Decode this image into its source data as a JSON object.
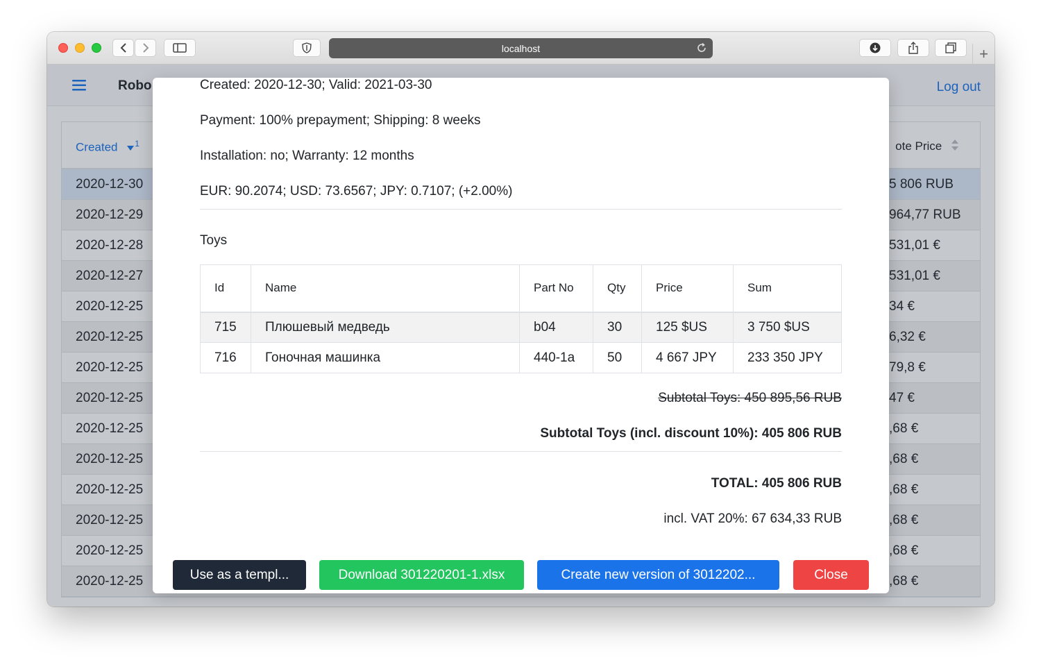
{
  "browser": {
    "url": "localhost",
    "icons": [
      "back-icon",
      "forward-icon",
      "sidebar-icon",
      "shield-icon",
      "reload-icon",
      "download-icon",
      "share-icon",
      "tabs-icon",
      "new-tab-icon"
    ]
  },
  "app": {
    "brand": "Robo",
    "logout": "Log out"
  },
  "background_table": {
    "header_created": "Created",
    "header_created_sort_index": "1",
    "header_price": "ote Price",
    "rows": [
      {
        "date": "2020-12-30",
        "price": "5 806 RUB"
      },
      {
        "date": "2020-12-29",
        "price": "964,77 RUB"
      },
      {
        "date": "2020-12-28",
        "price": "531,01 €"
      },
      {
        "date": "2020-12-27",
        "price": "531,01 €"
      },
      {
        "date": "2020-12-25",
        "price": "34 €"
      },
      {
        "date": "2020-12-25",
        "price": "6,32 €"
      },
      {
        "date": "2020-12-25",
        "price": "79,8 €"
      },
      {
        "date": "2020-12-25",
        "price": "47 €"
      },
      {
        "date": "2020-12-25",
        "price": ",68 €"
      },
      {
        "date": "2020-12-25",
        "price": ",68 €"
      },
      {
        "date": "2020-12-25",
        "price": ",68 €"
      },
      {
        "date": "2020-12-25",
        "price": ",68 €"
      },
      {
        "date": "2020-12-25",
        "price": ",68 €"
      },
      {
        "date": "2020-12-25",
        "price": ",68 €"
      }
    ]
  },
  "modal": {
    "info": {
      "created": "Created: 2020-12-30; Valid: 2021-03-30",
      "payment": "Payment: 100% prepayment; Shipping: 8 weeks",
      "installation": "Installation: no; Warranty: 12 months",
      "rates": "EUR: 90.2074; USD: 73.6567; JPY: 0.7107; (+2.00%)"
    },
    "section_title": "Toys",
    "table": {
      "headers": {
        "id": "Id",
        "name": "Name",
        "part_no": "Part No",
        "qty": "Qty",
        "price": "Price",
        "sum": "Sum"
      },
      "rows": [
        {
          "id": "715",
          "name": "Плюшевый медведь",
          "part_no": "b04",
          "qty": "30",
          "price": "125 $US",
          "sum": "3 750 $US"
        },
        {
          "id": "716",
          "name": "Гоночная машинка",
          "part_no": "440-1a",
          "qty": "50",
          "price": "4 667 JPY",
          "sum": "233 350 JPY"
        }
      ]
    },
    "subtotal_strike": "Subtotal Toys: 450 895,56 RUB",
    "subtotal_discount": "Subtotal Toys (incl. discount 10%): 405 806 RUB",
    "total": "TOTAL: 405 806 RUB",
    "vat": "incl. VAT 20%: 67 634,33 RUB",
    "buttons": {
      "use_template": "Use as a templ...",
      "download": "Download 301220201-1.xlsx",
      "new_version": "Create new version of 3012202...",
      "close": "Close"
    },
    "button_colors": {
      "dark": "#1f2937",
      "green": "#22c55e",
      "blue": "#1a73e8",
      "red": "#ef4444"
    }
  }
}
